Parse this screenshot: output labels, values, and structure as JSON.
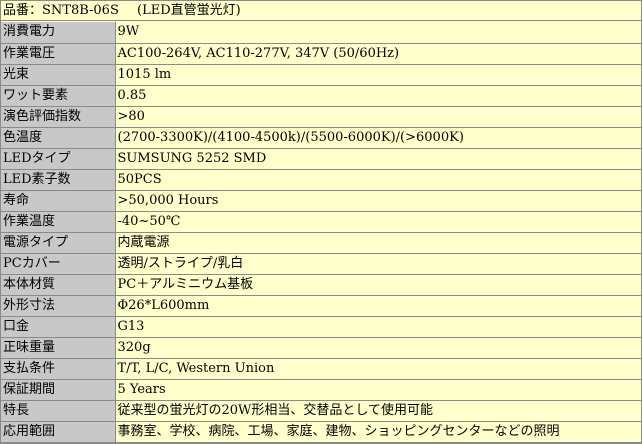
{
  "title": {
    "label": "品番：SNT8B-06S",
    "name": "(LED直管蛍光灯)"
  },
  "rows": [
    {
      "label": "消費電力",
      "value": "9W"
    },
    {
      "label": "作業電圧",
      "value": "AC100-264V, AC110-277V, 347V   (50/60Hz)"
    },
    {
      "label": "光束",
      "value": "1015 lm"
    },
    {
      "label": "ワット要素",
      "value": "0.85"
    },
    {
      "label": "演色評価指数",
      "value": ">80"
    },
    {
      "label": "色温度",
      "value": "(2700-3300K)/(4100-4500k)/(5500-6000K)/(>6000K)"
    },
    {
      "label": "LEDタイプ",
      "value": "SUMSUNG 5252 SMD"
    },
    {
      "label": "LED素子数",
      "value": "50PCS"
    },
    {
      "label": "寿命",
      "value": ">50,000 Hours"
    },
    {
      "label": "作業温度",
      "value": "-40~50℃"
    },
    {
      "label": "電源タイプ",
      "value": "内蔵電源"
    },
    {
      "label": "PCカバー",
      "value": "透明/ストライプ/乳白"
    },
    {
      "label": "本体材質",
      "value": "PC＋アルミニウム基板"
    },
    {
      "label": "外形寸法",
      "value": "Φ26*L600mm"
    },
    {
      "label": "口金",
      "value": "G13"
    },
    {
      "label": "正味重量",
      "value": "320g"
    },
    {
      "label": "支払条件",
      "value": "T/T, L/C, Western Union"
    },
    {
      "label": "保証期間",
      "value": "5 Years"
    },
    {
      "label": "特長",
      "value": "従来型の蛍光灯の20W形相当、交替品として使用可能"
    },
    {
      "label": "応用範囲",
      "value": "事務室、学校、病院、工場、家庭、建物、ショッピングセンターなどの照明"
    }
  ]
}
